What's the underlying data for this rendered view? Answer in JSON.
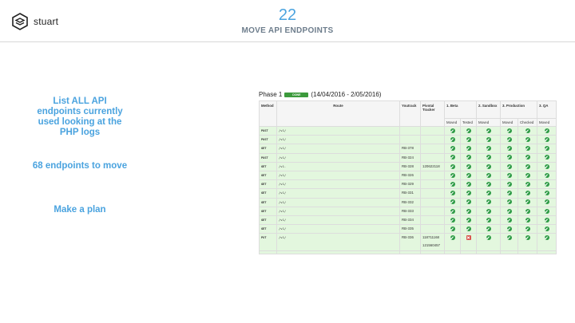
{
  "logo": {
    "text": "stuart"
  },
  "slide": {
    "number": "22",
    "title": "MOVE API ENDPOINTS"
  },
  "left": {
    "item1": "List ALL API endpoints currently used looking at the PHP logs",
    "item2": "68 endpoints to move",
    "item3": "Make a plan"
  },
  "phase": {
    "label": "Phase 1",
    "badge": "DONE",
    "dates": "(14/04/2016 - 2/05/2016)"
  },
  "table": {
    "headers": {
      "method": "Method",
      "route": "Route",
      "youtrack": "Youtrack",
      "pivotal": "Pivotal Tracker",
      "beta": "1. Beta",
      "sandbox": "2. Sandbox",
      "production": "3. Production",
      "qa": "3. QA"
    },
    "subheaders": {
      "beta_moved": "Moved",
      "beta_tested": "Tested",
      "sandbox_moved": "Moved",
      "prod_moved": "Moved",
      "prod_checked": "Checked",
      "qa_moved": "Moved"
    },
    "rows": [
      {
        "method": "POST",
        "route": "/v1/",
        "youtrack": "",
        "pivotal": "",
        "s": [
          "ok",
          "ok",
          "ok",
          "ok",
          "ok",
          "ok"
        ]
      },
      {
        "method": "POST",
        "route": "/v1/",
        "youtrack": "",
        "pivotal": "",
        "s": [
          "ok",
          "ok",
          "ok",
          "ok",
          "ok",
          "ok"
        ]
      },
      {
        "method": "GET",
        "route": "/v1/",
        "youtrack": "RB-378",
        "pivotal": "",
        "s": [
          "ok",
          "ok",
          "ok",
          "ok",
          "ok",
          "ok"
        ]
      },
      {
        "method": "POST",
        "route": "/v1/",
        "youtrack": "RB-324",
        "pivotal": "",
        "s": [
          "ok",
          "ok",
          "ok",
          "ok",
          "ok",
          "ok"
        ]
      },
      {
        "method": "GET",
        "route": "/v1.",
        "youtrack": "RB-328",
        "pivotal": "120622118",
        "s": [
          "ok",
          "ok",
          "ok",
          "ok",
          "ok",
          "ok"
        ]
      },
      {
        "method": "GET",
        "route": "/v1/",
        "youtrack": "RB-326",
        "pivotal": "",
        "s": [
          "ok",
          "ok",
          "ok",
          "ok",
          "ok",
          "ok"
        ]
      },
      {
        "method": "GET",
        "route": "/v1/",
        "youtrack": "RB-329",
        "pivotal": "",
        "s": [
          "ok",
          "ok",
          "ok",
          "ok",
          "ok",
          "ok"
        ]
      },
      {
        "method": "GET",
        "route": "/v1/",
        "youtrack": "RB-331",
        "pivotal": "",
        "s": [
          "ok",
          "ok",
          "ok",
          "ok",
          "ok",
          "ok"
        ]
      },
      {
        "method": "GET",
        "route": "/v1/",
        "youtrack": "RB-332",
        "pivotal": "",
        "s": [
          "ok",
          "ok",
          "ok",
          "ok",
          "ok",
          "ok"
        ]
      },
      {
        "method": "GET",
        "route": "/v1/",
        "youtrack": "RB-333",
        "pivotal": "",
        "s": [
          "ok",
          "ok",
          "ok",
          "ok",
          "ok",
          "ok"
        ]
      },
      {
        "method": "GET",
        "route": "/v1/",
        "youtrack": "RB-334",
        "pivotal": "",
        "s": [
          "ok",
          "ok",
          "ok",
          "ok",
          "ok",
          "ok"
        ]
      },
      {
        "method": "GET",
        "route": "/v1/",
        "youtrack": "RB-335",
        "pivotal": "",
        "s": [
          "ok",
          "ok",
          "ok",
          "ok",
          "ok",
          "ok"
        ]
      },
      {
        "method": "PUT",
        "route": "/v1/",
        "youtrack": "RB-336",
        "pivotal": "118711168",
        "pivotal2": "121560457",
        "s": [
          "ok",
          "fail",
          "ok",
          "ok",
          "ok",
          "ok"
        ]
      }
    ]
  }
}
